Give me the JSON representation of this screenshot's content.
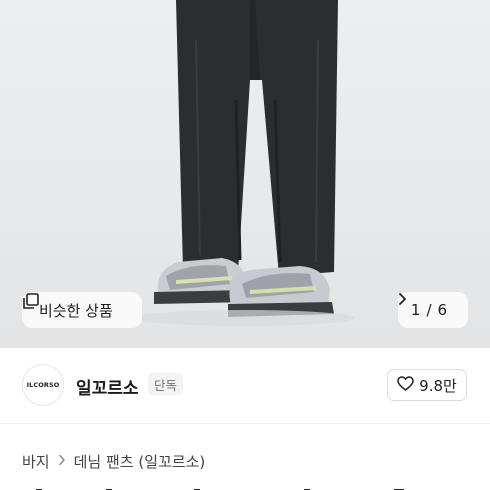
{
  "gallery": {
    "similar_label": "비슷한 상품",
    "current_page": "1",
    "separator": "/",
    "total_pages": "6"
  },
  "seller": {
    "logo_text": "ILCORSO",
    "name": "일꼬르소",
    "badge": "단독",
    "likes": "9.8만"
  },
  "breadcrumb": {
    "level1": "바지",
    "level2": "데님 팬츠 (일꼬르소)"
  },
  "icons": {
    "similar": "stack-cards-icon",
    "next": "chevron-right-icon",
    "like": "heart-outline-icon",
    "separator": "chevron-right-icon"
  }
}
